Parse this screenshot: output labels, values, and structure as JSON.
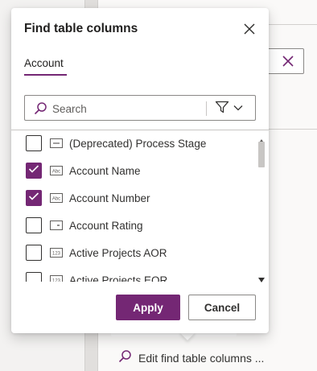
{
  "dialog": {
    "title": "Find table columns",
    "tab_label": "Account",
    "search_placeholder": "Search",
    "columns": [
      {
        "label": "(Deprecated) Process Stage",
        "checked": false,
        "type_icon": "option-set-icon"
      },
      {
        "label": "Account Name",
        "checked": true,
        "type_icon": "text-abc-icon"
      },
      {
        "label": "Account Number",
        "checked": true,
        "type_icon": "text-abc-icon"
      },
      {
        "label": "Account Rating",
        "checked": false,
        "type_icon": "option-set-icon"
      },
      {
        "label": "Active Projects AOR",
        "checked": false,
        "type_icon": "number-123-icon"
      },
      {
        "label": "Active Projects EOR",
        "checked": false,
        "type_icon": "number-123-icon"
      }
    ],
    "apply_label": "Apply",
    "cancel_label": "Cancel"
  },
  "background": {
    "edit_link_label": "Edit find table columns ..."
  },
  "colors": {
    "accent": "#742774"
  }
}
